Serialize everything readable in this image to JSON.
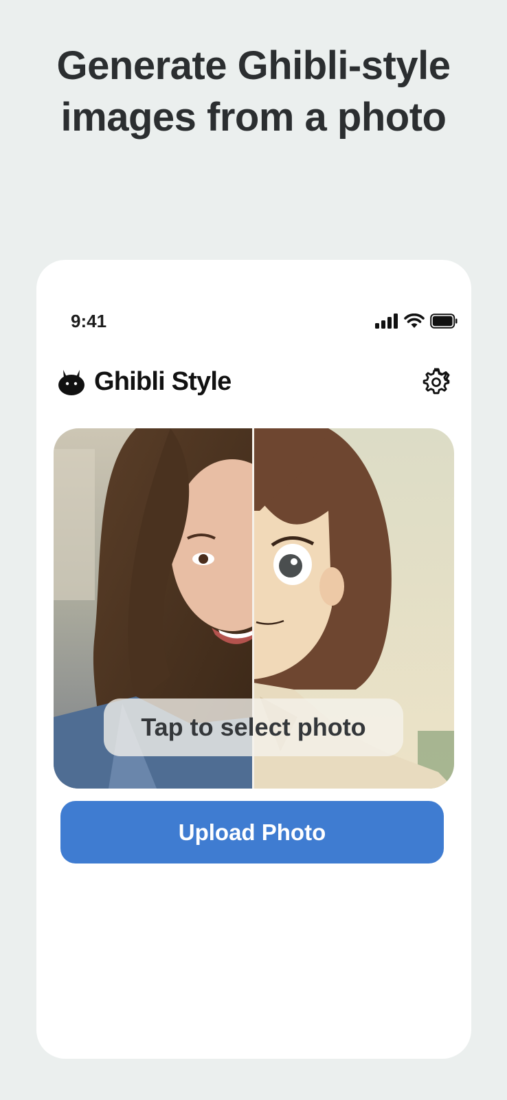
{
  "headline": {
    "line1": "Generate Ghibli-style",
    "line2": "images from a photo"
  },
  "status_bar": {
    "time": "9:41",
    "icons": [
      "cellular-signal-icon",
      "wifi-icon",
      "battery-icon"
    ]
  },
  "app": {
    "title": "Ghibli Style",
    "logo_icon": "bunny-icon",
    "settings_icon": "gear-icon"
  },
  "photo_picker": {
    "overlay_label": "Tap to select photo"
  },
  "upload_button": {
    "label": "Upload Photo"
  },
  "colors": {
    "background": "#ebefee",
    "card": "#ffffff",
    "accent": "#3f7cd1",
    "text": "#2b2e30"
  }
}
